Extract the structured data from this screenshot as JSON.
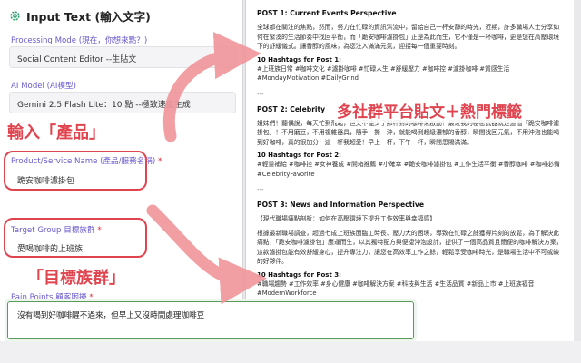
{
  "form": {
    "title": "Input Text (輸入文字)",
    "processing_mode": {
      "label": "Processing Mode (現在，你想來點？)",
      "value": "Social Content Editor --生貼文"
    },
    "ai_model": {
      "label": "AI Model (AI模型)",
      "value": "Gemini 2.5 Flash Lite：10 點 --極致速度生成"
    },
    "product": {
      "label": "Product/Service Name (產品/服務名稱)",
      "required": "*",
      "value": "跪安咖啡濾掛包"
    },
    "target_group": {
      "label": "Target Group 目標族群",
      "required": "*",
      "value": "愛喝咖啡的上班族"
    },
    "pain_points": {
      "label": "Pain Points 顧客困擾",
      "required": "*",
      "value": "沒有喝到好咖啡醒不過來，但早上又沒時間處理咖啡豆"
    }
  },
  "annotations": {
    "product": "輸入「產品」",
    "target": "「目標族群」",
    "output": "多社群平台貼文＋熱門標籤"
  },
  "document": {
    "posts": [
      {
        "heading": "POST 1: Current Events Perspective",
        "body": "全球都在關注的焦點，然而，努力在忙碌的資訊洪流中，留給自己一杯安靜的時光，近期，許多職場人士分享如何在緊湊的生活節奏中找回平衡，而「跪安咖啡濾掛包」正是為此而生，它不僅是一杯咖啡，更是您在高壓環境下的舒緩儀式。讓香醇的風味，為您注入滿滿元氣，迎接每一個重要時刻。",
        "hashtag_title": "10 Hashtags for Post 1:",
        "hashtags": "#上班族日常 #咖啡文化 #濾掛咖啡 #忙碌人生 #舒緩壓力 #咖啡控 #濾掛咖啡 #質感生活 #MondayMotivation #DailyGrind"
      },
      {
        "heading": "POST 2: Celebrity",
        "body": "姐妹們！聽偶說，每天忙到飛起，但又不能少了那杯對的咖啡來啟動！最近我的秘密武器就是這個「跪安咖啡濾掛包」！不用磨豆，不用複雜器具，隨手一撕一沖，就能喝到超級濃郁的香醇，瞬間找回元氣，不用沖泡也能喝到好咖啡，真的很加分！這一杯我超愛！早上一杯，下午一杯，瞬間恩賜滿滿。",
        "hashtag_title": "10 Hashtags for Post 2:",
        "hashtags": "#輕量補給 #咖啡控 #女神養成 #開箱推薦 #小確幸 #跪安咖啡濾掛包 #工作生活平衡 #香醇咖啡 #咖啡必備 #CelebrityFavorite"
      },
      {
        "heading": "POST 3: News and Information Perspective",
        "intro": "【現代職場痛點剖析：如何在高壓環境下提升工作效率與幸福感】",
        "body": "根據最新職場調查，超過七成上班族面臨工時長、壓力大的困境，導致在忙碌之餘獲得片刻的放鬆，為了解決此痛點，「跪安咖啡濾掛包」應運而生，以其獨特配方與便捷沖泡設計，提供了一個高品質且簡便的咖啡解決方案，這款濾掛包能有效舒緩身心，提升專注力，讓您在高效率工作之餘，輕鬆享受咖啡時光，是職場生活中不可或缺的好夥伴。",
        "hashtag_title": "10 Hashtags for Post 3:",
        "hashtags": "#職場趨勢 #工作效率 #身心健康 #咖啡解決方案 #科技與生活 #生活品質 #新品上市 #上班族福音 #ModernWorkforce"
      }
    ],
    "separator": "---"
  },
  "colors": {
    "accent": "#e0444f",
    "label": "#6a5acd",
    "focus": "#5a9a5a"
  }
}
